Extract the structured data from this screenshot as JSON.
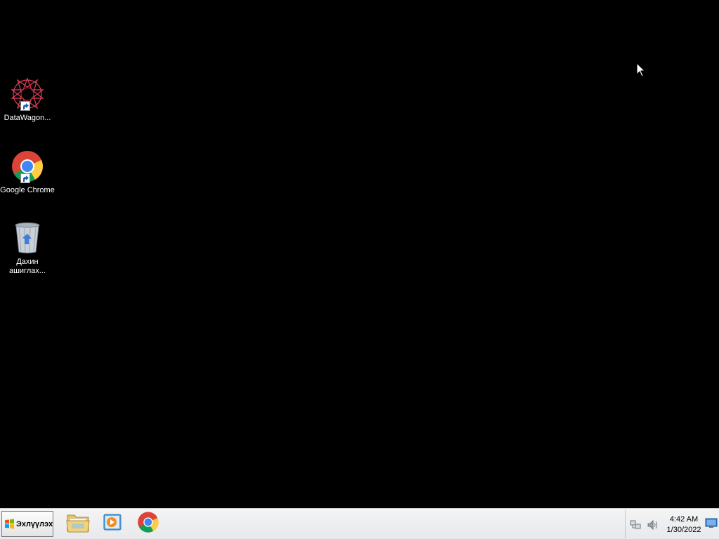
{
  "desktop": {
    "icons": [
      {
        "label": "DataWagon...",
        "icon": "datawagon-icon"
      },
      {
        "label": "Google Chrome",
        "icon": "chrome-icon"
      },
      {
        "label": "Дахин ашиглах...",
        "icon": "recycle-bin-icon"
      }
    ]
  },
  "taskbar": {
    "start_label": "Эхлүүлэх",
    "pinned": [
      {
        "name": "windows-explorer",
        "icon": "folder-icon"
      },
      {
        "name": "media-player",
        "icon": "media-player-icon"
      },
      {
        "name": "google-chrome",
        "icon": "chrome-icon"
      }
    ],
    "tray": {
      "time": "4:42 AM",
      "date": "1/30/2022"
    }
  },
  "colors": {
    "desktop_bg": "#000000",
    "taskbar_bg": "#eceef0"
  }
}
